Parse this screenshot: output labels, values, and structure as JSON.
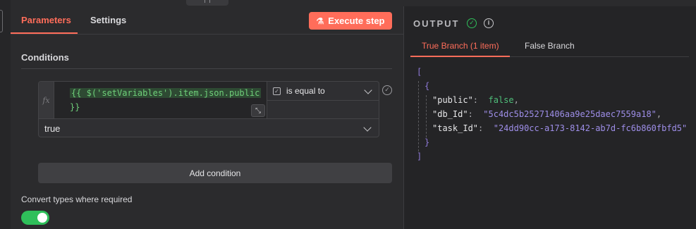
{
  "params_panel": {
    "tabs": [
      {
        "label": "Parameters",
        "active": true
      },
      {
        "label": "Settings",
        "active": false
      }
    ],
    "execute_label": "Execute step",
    "conditions_title": "Conditions",
    "condition": {
      "fx_label": "fx",
      "expression": "{{ $('setVariables').item.json.public }}",
      "expression_line1": "{{ $('setVariables').item.json.public",
      "expression_line2": "}}",
      "operator": "is equal to",
      "value": "true"
    },
    "add_condition_label": "Add condition",
    "convert_label": "Convert types where required",
    "convert_enabled": true
  },
  "output_panel": {
    "title": "OUTPUT",
    "tabs": [
      {
        "label": "True Branch (1 item)",
        "active": true
      },
      {
        "label": "False Branch",
        "active": false
      }
    ],
    "json_lines": {
      "open_array": "[",
      "open_obj": "{",
      "public_key": "\"public\"",
      "public_val": "false",
      "db_key": "\"db_Id\"",
      "db_val": "\"5c4dc5b25271406aa9e25daec7559a18\"",
      "task_key": "\"task_Id\"",
      "task_val": "\"24dd90cc-a173-8142-ab7d-fc6b860fbfd5\"",
      "close_obj": "}",
      "close_array": "]"
    }
  },
  "colors": {
    "accent": "#ff6d5a",
    "success": "#2fbf5a",
    "string": "#9e8ee8",
    "expression": "#6fcf7a"
  },
  "icons": [
    "flask-icon",
    "fx-icon",
    "expand-icon",
    "checkbox-icon",
    "chevron-down-icon",
    "check-circle-icon",
    "info-icon"
  ]
}
